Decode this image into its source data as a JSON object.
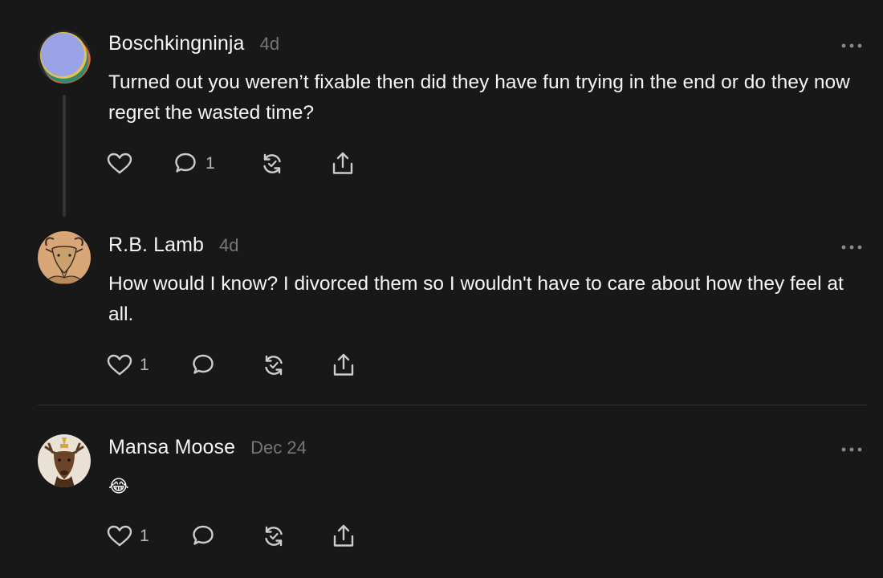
{
  "posts": [
    {
      "username": "Boschkingninja",
      "time": "4d",
      "text": "Turned out you weren’t fixable then did they have fun trying in the end or do they now regret the wasted time?",
      "like_count": "",
      "reply_count": "1"
    },
    {
      "username": "R.B. Lamb",
      "time": "4d",
      "text": "How would I know? I divorced them so I wouldn't have to care about how they feel at all.",
      "like_count": "1",
      "reply_count": ""
    },
    {
      "username": "Mansa Moose",
      "time": "Dec 24",
      "text": "😂",
      "like_count": "1",
      "reply_count": ""
    }
  ],
  "icons": {
    "like": "heart-icon",
    "reply": "comment-icon",
    "repost": "repost-icon",
    "share": "share-icon",
    "more": "more-options-icon"
  },
  "colors": {
    "background": "#181818",
    "text": "#f3f5f7",
    "secondary": "#777777",
    "icon": "#cccccc",
    "divider": "#333333"
  }
}
